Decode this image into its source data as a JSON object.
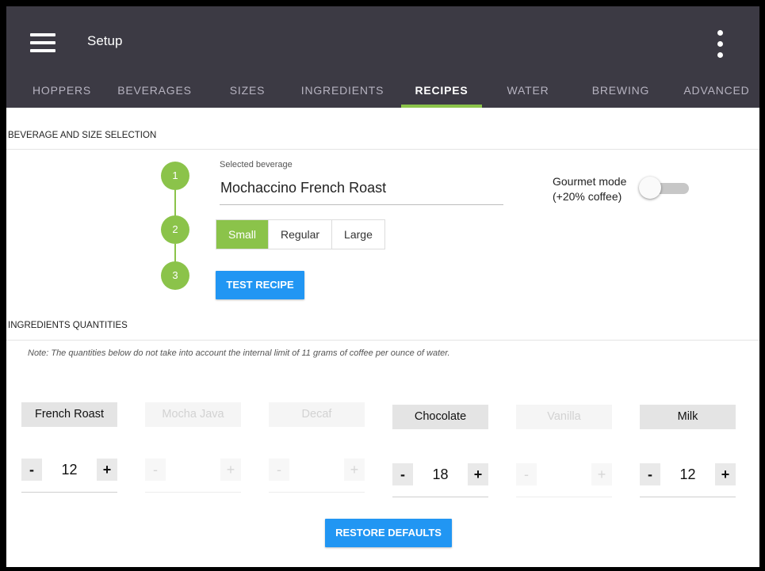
{
  "app": {
    "title": "Setup"
  },
  "tabs": [
    {
      "label": "HOPPERS",
      "active": false
    },
    {
      "label": "BEVERAGES",
      "active": false
    },
    {
      "label": "SIZES",
      "active": false
    },
    {
      "label": "INGREDIENTS",
      "active": false
    },
    {
      "label": "RECIPES",
      "active": true
    },
    {
      "label": "WATER",
      "active": false
    },
    {
      "label": "BREWING",
      "active": false
    },
    {
      "label": "ADVANCED",
      "active": false
    }
  ],
  "selection": {
    "heading": "BEVERAGE AND SIZE SELECTION",
    "steps": [
      "1",
      "2",
      "3"
    ],
    "beverage_label": "Selected beverage",
    "beverage_value": "Mochaccino French Roast",
    "gourmet_line1": "Gourmet mode",
    "gourmet_line2": "(+20% coffee)",
    "gourmet_on": false,
    "sizes": [
      "Small",
      "Regular",
      "Large"
    ],
    "selected_size": "Small",
    "test_button": "TEST RECIPE"
  },
  "ingredients": {
    "heading": "INGREDIENTS QUANTITIES",
    "note": "Note: The quantities below do not take into account the internal limit of 11 grams of coffee per ounce of water.",
    "items": [
      {
        "name": "French Roast",
        "qty": "12",
        "enabled": true
      },
      {
        "name": "Mocha Java",
        "qty": "",
        "enabled": false
      },
      {
        "name": "Decaf",
        "qty": "",
        "enabled": false
      },
      {
        "name": "Chocolate",
        "qty": "18",
        "enabled": true
      },
      {
        "name": "Vanilla",
        "qty": "",
        "enabled": false
      },
      {
        "name": "Milk",
        "qty": "12",
        "enabled": true
      }
    ],
    "minus": "-",
    "plus": "+",
    "restore_button": "RESTORE DEFAULTS"
  },
  "colors": {
    "appbar": "#3c3a44",
    "accent_green": "#8bc34a",
    "button_blue": "#2196f3"
  }
}
